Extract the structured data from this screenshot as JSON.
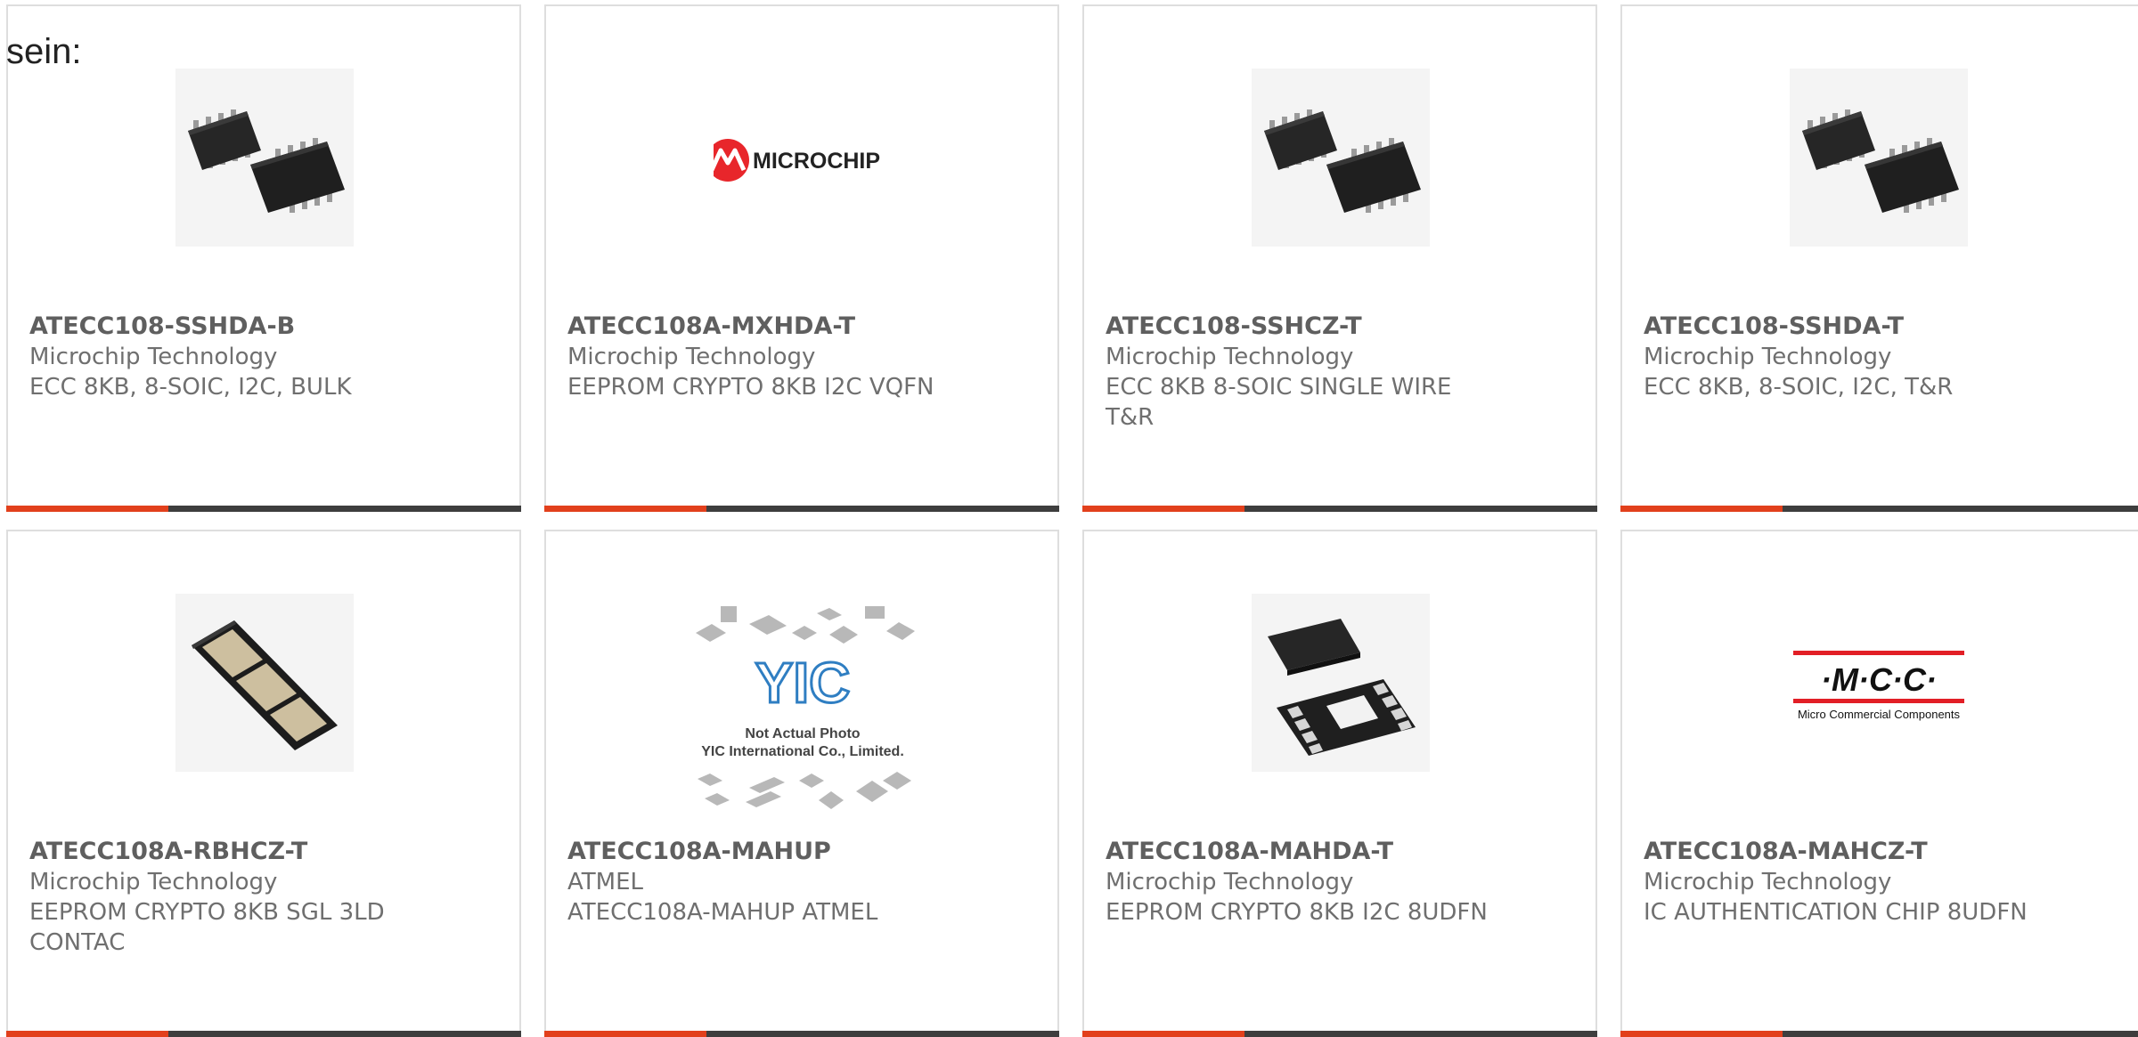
{
  "page": {
    "intro_text": "sein:"
  },
  "colors": {
    "accent": "#e2401c",
    "bar": "#3e3e3e",
    "border": "#dedede",
    "text": "#6f6f6f"
  },
  "products": [
    {
      "part_number": "ATECC108-SSHDA-B",
      "manufacturer": "Microchip Technology",
      "description": "ECC 8KB, 8-SOIC, I2C, BULK",
      "image": "soic-8-chip-pair"
    },
    {
      "part_number": "ATECC108A-MXHDA-T",
      "manufacturer": "Microchip Technology",
      "description": "EEPROM CRYPTO 8KB I2C VQFN",
      "image": "microchip-logo",
      "logo_text": "MICROCHIP"
    },
    {
      "part_number": "ATECC108-SSHCZ-T",
      "manufacturer": "Microchip Technology",
      "description": "ECC 8KB 8-SOIC SINGLE WIRE T&R",
      "image": "soic-8-chip-pair"
    },
    {
      "part_number": "ATECC108-SSHDA-T",
      "manufacturer": "Microchip Technology",
      "description": "ECC 8KB, 8-SOIC, I2C, T&R",
      "image": "soic-8-chip-pair"
    },
    {
      "part_number": "ATECC108A-RBHCZ-T",
      "manufacturer": "Microchip Technology",
      "description": "EEPROM CRYPTO 8KB SGL 3LD CONTAC",
      "image": "contact-module"
    },
    {
      "part_number": "ATECC108A-MAHUP",
      "manufacturer": "ATMEL",
      "description": "ATECC108A-MAHUP ATMEL",
      "image": "yic-not-actual-photo",
      "logo_text": "YIC",
      "caption_1": "Not Actual Photo",
      "caption_2": "YIC International Co., Limited."
    },
    {
      "part_number": "ATECC108A-MAHDA-T",
      "manufacturer": "Microchip Technology",
      "description": "EEPROM CRYPTO 8KB I2C 8UDFN",
      "image": "udfn-8-chip"
    },
    {
      "part_number": "ATECC108A-MAHCZ-T",
      "manufacturer": "Microchip Technology",
      "description": "IC AUTHENTICATION CHIP 8UDFN",
      "image": "mcc-logo",
      "logo_text": "·M·C·C·",
      "logo_subtext": "Micro Commercial Components"
    }
  ]
}
